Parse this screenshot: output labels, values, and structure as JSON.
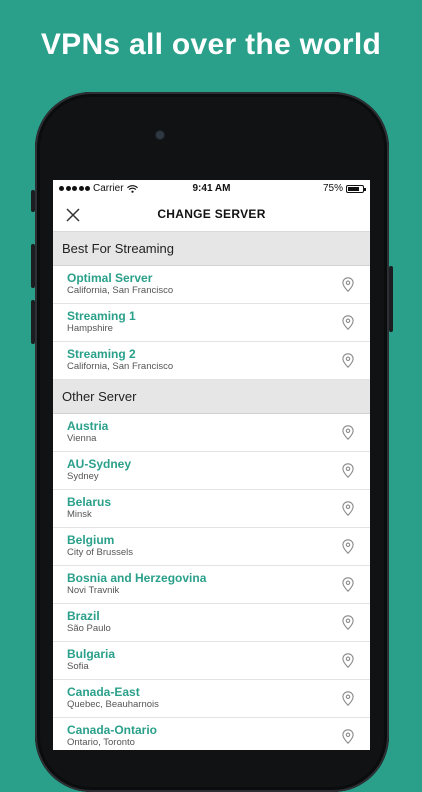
{
  "headline": "VPNs all over the world",
  "status_bar": {
    "carrier": "Carrier",
    "time": "9:41 AM",
    "battery": "75%",
    "battery_level": 0.75
  },
  "nav": {
    "title": "CHANGE SERVER",
    "close_icon": "close-icon"
  },
  "sections": [
    {
      "title": "Best For Streaming",
      "servers": [
        {
          "name": "Optimal Server",
          "location": "California, San Francisco"
        },
        {
          "name": "Streaming 1",
          "location": "Hampshire"
        },
        {
          "name": "Streaming 2",
          "location": "California, San Francisco"
        }
      ]
    },
    {
      "title": "Other Server",
      "servers": [
        {
          "name": "Austria",
          "location": "Vienna"
        },
        {
          "name": "AU-Sydney",
          "location": "Sydney"
        },
        {
          "name": "Belarus",
          "location": "Minsk"
        },
        {
          "name": "Belgium",
          "location": "City of Brussels"
        },
        {
          "name": "Bosnia and Herzegovina",
          "location": "Novi Travnik"
        },
        {
          "name": "Brazil",
          "location": "São Paulo"
        },
        {
          "name": "Bulgaria",
          "location": "Sofia"
        },
        {
          "name": "Canada-East",
          "location": "Quebec, Beauharnois"
        },
        {
          "name": "Canada-Ontario",
          "location": "Ontario, Toronto"
        }
      ]
    }
  ],
  "colors": {
    "background": "#2aa08a",
    "accent": "#2aa08a",
    "section_bg": "#e6e6e6"
  }
}
